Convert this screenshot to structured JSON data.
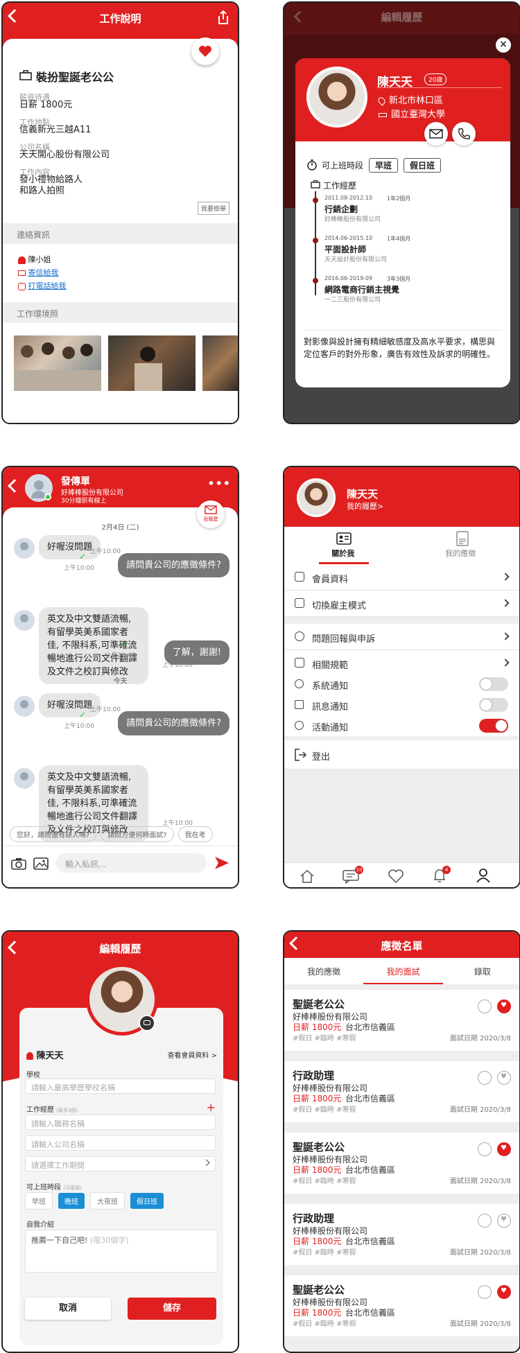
{
  "colors": {
    "accent": "#e02020",
    "toggle_off": "#dddddd",
    "bubble_me": "#777777",
    "bubble_them": "#e6e6e6"
  },
  "screen1": {
    "header_title": "工作說明",
    "job_title": "裝扮聖誕老公公",
    "fields": [
      {
        "label": "薪資待遇",
        "value": "日薪 1800元"
      },
      {
        "label": "工作地點",
        "value": "信義新光三越A11"
      },
      {
        "label": "公司名稱",
        "value": "天天開心股份有限公司"
      },
      {
        "label": "工作內容",
        "value": "發小禮物給路人\n和路人拍照"
      }
    ],
    "report_button": "我要檢舉",
    "contact_section": "連絡資訊",
    "contact_name": "陳小姐",
    "contact_email": "寄信給我",
    "contact_phone": "打電話給我",
    "env_section": "工作環境照"
  },
  "screen2": {
    "header_title": "編輯履歷",
    "name": "陳天天",
    "age_badge": "20歲",
    "location": "新北市林口區",
    "school": "國立臺灣大學",
    "availability_label": "可上班時段",
    "availability_tags": [
      "早班",
      "假日班"
    ],
    "experience_label": "工作經歷",
    "experiences": [
      {
        "period": "2011.08-2012.10",
        "duration": "1年2個月",
        "title": "行銷企劃",
        "company": "好棒棒股份有限公司"
      },
      {
        "period": "2014.06-2015.10",
        "duration": "1年4個月",
        "title": "平面設計師",
        "company": "天天設計股份有限公司"
      },
      {
        "period": "2016.06-2019.09",
        "duration": "3年3個月",
        "title": "網路電商行銷主視覺",
        "company": "一二三股份有限公司"
      }
    ],
    "bio": "對影像與設計擁有精細敏感度及高水平要求，構思與定位客戶的對外形象，廣告有效性及訴求的明確性。"
  },
  "screen3": {
    "chat_name": "發傳單",
    "chat_company": "好棒棒股份有限公司",
    "chat_status": "30分鐘前有線上",
    "resume_badge": "投履歷",
    "date1": "2月4日 (二)",
    "date2": "今天",
    "messages": [
      {
        "who": "them",
        "text": "好喔沒問題",
        "time": "上午10:00"
      },
      {
        "who": "me",
        "text": "請問貴公司的應徵條件?",
        "time": "上午10:00"
      },
      {
        "who": "them",
        "text": "英文及中文雙語流暢, 有留學英美系國家者佳, 不限科系,可準確流暢地進行公司文件翻譯及文件之校訂與修改",
        "time": "上午10:00"
      },
      {
        "who": "me",
        "text": "了解，謝謝!",
        "time": "上午10:02"
      },
      {
        "who": "them",
        "text": "好喔沒問題",
        "time": "上午10:00"
      },
      {
        "who": "me",
        "text": "請問貴公司的應徵條件?",
        "time": "上午10:00"
      },
      {
        "who": "them",
        "text": "英文及中文雙語流暢, 有留學英美系國家者佳, 不限科系,可準確流暢地進行公司文件翻譯及文件之校訂與修改",
        "time": "上午10:00"
      }
    ],
    "quick_replies": [
      "您好，請問還有缺人嗎?",
      "請問方便何時面試?",
      "我在考"
    ],
    "input_placeholder": "輸入私訊..."
  },
  "screen4": {
    "name": "陳天天",
    "resume_link": "我的履歷>",
    "tab_about": "關於我",
    "tab_applied": "我的應徵",
    "menu": [
      "會員資料",
      "切換雇主模式",
      "問題回報與申訴",
      "相關規範"
    ],
    "toggles": [
      {
        "label": "系統通知",
        "on": false
      },
      {
        "label": "訊息通知",
        "on": false
      },
      {
        "label": "活動通知",
        "on": true
      }
    ],
    "logout": "登出",
    "badge_msg": "10",
    "badge_bell": "4"
  },
  "screen5": {
    "header_title": "編輯履歷",
    "name": "陳天天",
    "view_member": "查看會員資料 >",
    "school_label": "學校",
    "school_placeholder": "請輸入最高學歷學校名稱",
    "exp_label": "工作經歷",
    "exp_hint": "(最多3個)",
    "title_placeholder": "請輸入職務名稱",
    "company_placeholder": "請輸入公司名稱",
    "period_placeholder": "請選擇工作期間",
    "shift_label": "可上班時段",
    "shift_hint": "(可複選)",
    "shifts": [
      {
        "label": "早班",
        "on": false
      },
      {
        "label": "晚班",
        "on": true
      },
      {
        "label": "大夜班",
        "on": false
      },
      {
        "label": "假日班",
        "on": true
      }
    ],
    "intro_label": "自我介紹",
    "intro_placeholder": "推薦一下自己吧!",
    "intro_hint": "(限30個字)",
    "cancel": "取消",
    "save": "儲存"
  },
  "screen6": {
    "header_title": "應徵名單",
    "tabs": [
      "我的應徵",
      "我的面試",
      "錄取"
    ],
    "jobs": [
      {
        "title": "聖誕老公公",
        "company": "好棒棒股份有限公司",
        "pay": "日薪 1800元",
        "location": "台北市信義區",
        "tags": "#假日 #臨時 #寒假",
        "date": "面試日期 2020/3/8",
        "liked": true
      },
      {
        "title": "行政助理",
        "company": "好棒棒股份有限公司",
        "pay": "日薪 1800元",
        "location": "台北市信義區",
        "tags": "#假日 #臨時 #寒假",
        "date": "面試日期 2020/3/8",
        "liked": false
      },
      {
        "title": "聖誕老公公",
        "company": "好棒棒股份有限公司",
        "pay": "日薪 1800元",
        "location": "台北市信義區",
        "tags": "#假日 #臨時 #寒假",
        "date": "面試日期 2020/3/8",
        "liked": true
      },
      {
        "title": "行政助理",
        "company": "好棒棒股份有限公司",
        "pay": "日薪 1800元",
        "location": "台北市信義區",
        "tags": "#假日 #臨時 #寒假",
        "date": "面試日期 2020/3/8",
        "liked": false
      },
      {
        "title": "聖誕老公公",
        "company": "好棒棒股份有限公司",
        "pay": "日薪 1800元",
        "location": "台北市信義區",
        "tags": "#假日 #臨時 #寒假",
        "date": "面試日期 2020/3/8",
        "liked": true
      }
    ]
  }
}
